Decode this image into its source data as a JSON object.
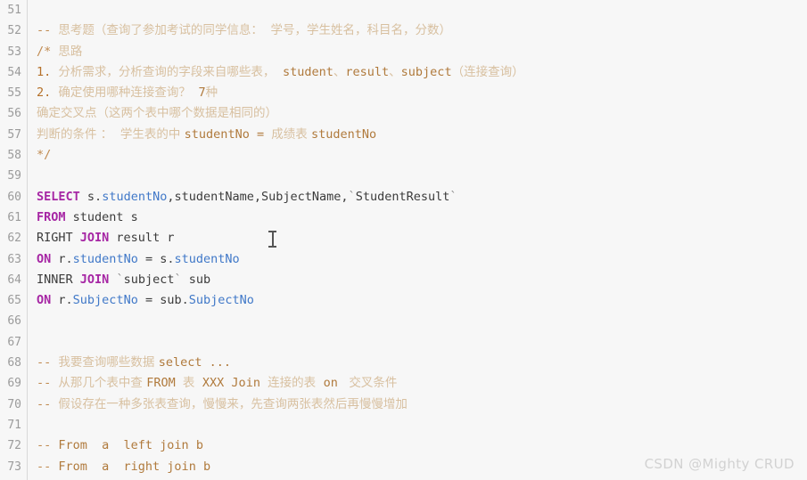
{
  "editor": {
    "first_line_number": 51,
    "last_line_number": 73,
    "background_color": "#f7f7f7",
    "gutter_color": "#9b9b9b",
    "comment_color": "#d8c0a0",
    "keyword_color": "#a626a4",
    "identifier_color": "#4078c8"
  },
  "watermark": {
    "text": "CSDN @Mighty CRUD"
  },
  "lines": [
    {
      "num": "51",
      "tokens": []
    },
    {
      "num": "52",
      "tokens": [
        {
          "t": "-- ",
          "c": "cm-dash"
        },
        {
          "t": "思考题（查询了参加考试的同学信息：  学号，学生姓名，科目名，分数）",
          "c": "cm-zh"
        }
      ]
    },
    {
      "num": "53",
      "tokens": [
        {
          "t": "/* ",
          "c": "cm-dash"
        },
        {
          "t": "思路",
          "c": "cm-zh"
        }
      ]
    },
    {
      "num": "54",
      "tokens": [
        {
          "t": "1. ",
          "c": "cm-num"
        },
        {
          "t": "分析需求，分析查询的字段来自哪些表，  ",
          "c": "cm-zh"
        },
        {
          "t": "student",
          "c": "cm-lat"
        },
        {
          "t": "、",
          "c": "cm-zh"
        },
        {
          "t": "result",
          "c": "cm-lat"
        },
        {
          "t": "、",
          "c": "cm-zh"
        },
        {
          "t": "subject",
          "c": "cm-lat"
        },
        {
          "t": "（连接查询）",
          "c": "cm-zh"
        }
      ]
    },
    {
      "num": "55",
      "tokens": [
        {
          "t": "2. ",
          "c": "cm-num"
        },
        {
          "t": "确定使用哪种连接查询？  ",
          "c": "cm-zh"
        },
        {
          "t": "7",
          "c": "cm-lat"
        },
        {
          "t": "种",
          "c": "cm-zh"
        }
      ]
    },
    {
      "num": "56",
      "tokens": [
        {
          "t": "确定交叉点（这两个表中哪个数据是相同的）",
          "c": "cm-zh"
        }
      ]
    },
    {
      "num": "57",
      "tokens": [
        {
          "t": "判断的条件 ：  学生表的中 ",
          "c": "cm-zh"
        },
        {
          "t": "studentNo",
          "c": "cm-lat"
        },
        {
          "t": " = ",
          "c": "cm-lat"
        },
        {
          "t": "成绩表 ",
          "c": "cm-zh"
        },
        {
          "t": "studentNo",
          "c": "cm-lat"
        }
      ]
    },
    {
      "num": "58",
      "tokens": [
        {
          "t": "*/",
          "c": "cm-dash"
        }
      ]
    },
    {
      "num": "59",
      "tokens": []
    },
    {
      "num": "60",
      "tokens": [
        {
          "t": "SELECT",
          "c": "kw"
        },
        {
          "t": " s",
          "c": "plain"
        },
        {
          "t": ".",
          "c": "punct"
        },
        {
          "t": "studentNo",
          "c": "ident"
        },
        {
          "t": ",studentName,SubjectName,",
          "c": "plain"
        },
        {
          "t": "`",
          "c": "tick"
        },
        {
          "t": "StudentResult",
          "c": "plain"
        },
        {
          "t": "`",
          "c": "tick"
        }
      ]
    },
    {
      "num": "61",
      "tokens": [
        {
          "t": "FROM",
          "c": "kw"
        },
        {
          "t": " student s",
          "c": "plain"
        }
      ]
    },
    {
      "num": "62",
      "tokens": [
        {
          "t": "RIGHT ",
          "c": "plain"
        },
        {
          "t": "JOIN",
          "c": "kw"
        },
        {
          "t": " result r",
          "c": "plain"
        }
      ]
    },
    {
      "num": "63",
      "tokens": [
        {
          "t": "ON",
          "c": "kw"
        },
        {
          "t": " r",
          "c": "plain"
        },
        {
          "t": ".",
          "c": "punct"
        },
        {
          "t": "studentNo",
          "c": "ident"
        },
        {
          "t": " = s",
          "c": "plain"
        },
        {
          "t": ".",
          "c": "punct"
        },
        {
          "t": "studentNo",
          "c": "ident"
        }
      ]
    },
    {
      "num": "64",
      "tokens": [
        {
          "t": "INNER ",
          "c": "plain"
        },
        {
          "t": "JOIN",
          "c": "kw"
        },
        {
          "t": " ",
          "c": "plain"
        },
        {
          "t": "`",
          "c": "tick"
        },
        {
          "t": "subject",
          "c": "plain"
        },
        {
          "t": "`",
          "c": "tick"
        },
        {
          "t": " sub",
          "c": "plain"
        }
      ]
    },
    {
      "num": "65",
      "tokens": [
        {
          "t": "ON",
          "c": "kw"
        },
        {
          "t": " r",
          "c": "plain"
        },
        {
          "t": ".",
          "c": "punct"
        },
        {
          "t": "SubjectNo",
          "c": "ident"
        },
        {
          "t": " = sub",
          "c": "plain"
        },
        {
          "t": ".",
          "c": "punct"
        },
        {
          "t": "SubjectNo",
          "c": "ident"
        }
      ]
    },
    {
      "num": "66",
      "tokens": []
    },
    {
      "num": "67",
      "tokens": []
    },
    {
      "num": "68",
      "tokens": [
        {
          "t": "-- ",
          "c": "cm-dash"
        },
        {
          "t": "我要查询哪些数据 ",
          "c": "cm-zh"
        },
        {
          "t": "select ...",
          "c": "cm-lat"
        }
      ]
    },
    {
      "num": "69",
      "tokens": [
        {
          "t": "-- ",
          "c": "cm-dash"
        },
        {
          "t": "从那几个表中查 ",
          "c": "cm-zh"
        },
        {
          "t": "FROM ",
          "c": "cm-lat"
        },
        {
          "t": "表  ",
          "c": "cm-zh"
        },
        {
          "t": "XXX Join ",
          "c": "cm-lat"
        },
        {
          "t": "连接的表  ",
          "c": "cm-zh"
        },
        {
          "t": "on ",
          "c": "cm-lat"
        },
        {
          "t": " 交叉条件",
          "c": "cm-zh"
        }
      ]
    },
    {
      "num": "70",
      "tokens": [
        {
          "t": "-- ",
          "c": "cm-dash"
        },
        {
          "t": "假设存在一种多张表查询，慢慢来，先查询两张表然后再慢慢增加",
          "c": "cm-zh"
        }
      ]
    },
    {
      "num": "71",
      "tokens": []
    },
    {
      "num": "72",
      "tokens": [
        {
          "t": "-- ",
          "c": "cm-dash"
        },
        {
          "t": "From  a  left join b",
          "c": "cm-lat"
        }
      ]
    },
    {
      "num": "73",
      "tokens": [
        {
          "t": "-- ",
          "c": "cm-dash"
        },
        {
          "t": "From  a  right join b",
          "c": "cm-lat"
        }
      ]
    }
  ]
}
